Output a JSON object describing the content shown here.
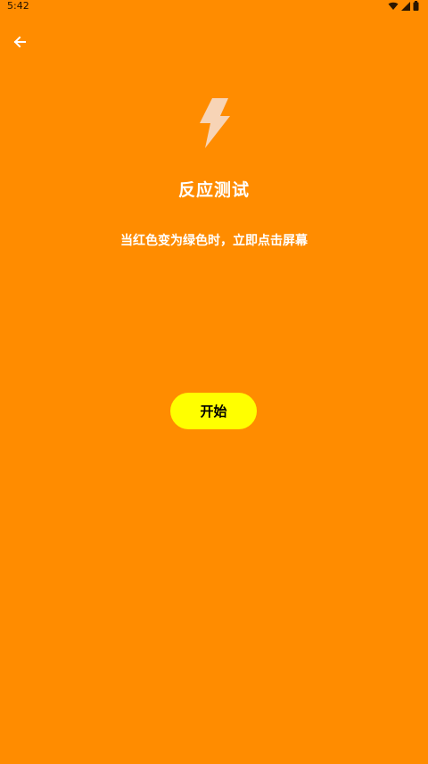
{
  "status_bar": {
    "time": "5:42",
    "icons": [
      "wifi-icon",
      "signal-icon",
      "battery-icon"
    ]
  },
  "header": {
    "back_icon": "arrow-left-icon"
  },
  "main": {
    "hero_icon": "lightning-icon",
    "title": "反应测试",
    "instruction": "当红色变为绿色时，立即点击屏幕",
    "start_button": "开始"
  },
  "colors": {
    "background": "#FF8C00",
    "button": "#FFFF00",
    "text": "#FFFFFF",
    "button_text": "#000000"
  }
}
